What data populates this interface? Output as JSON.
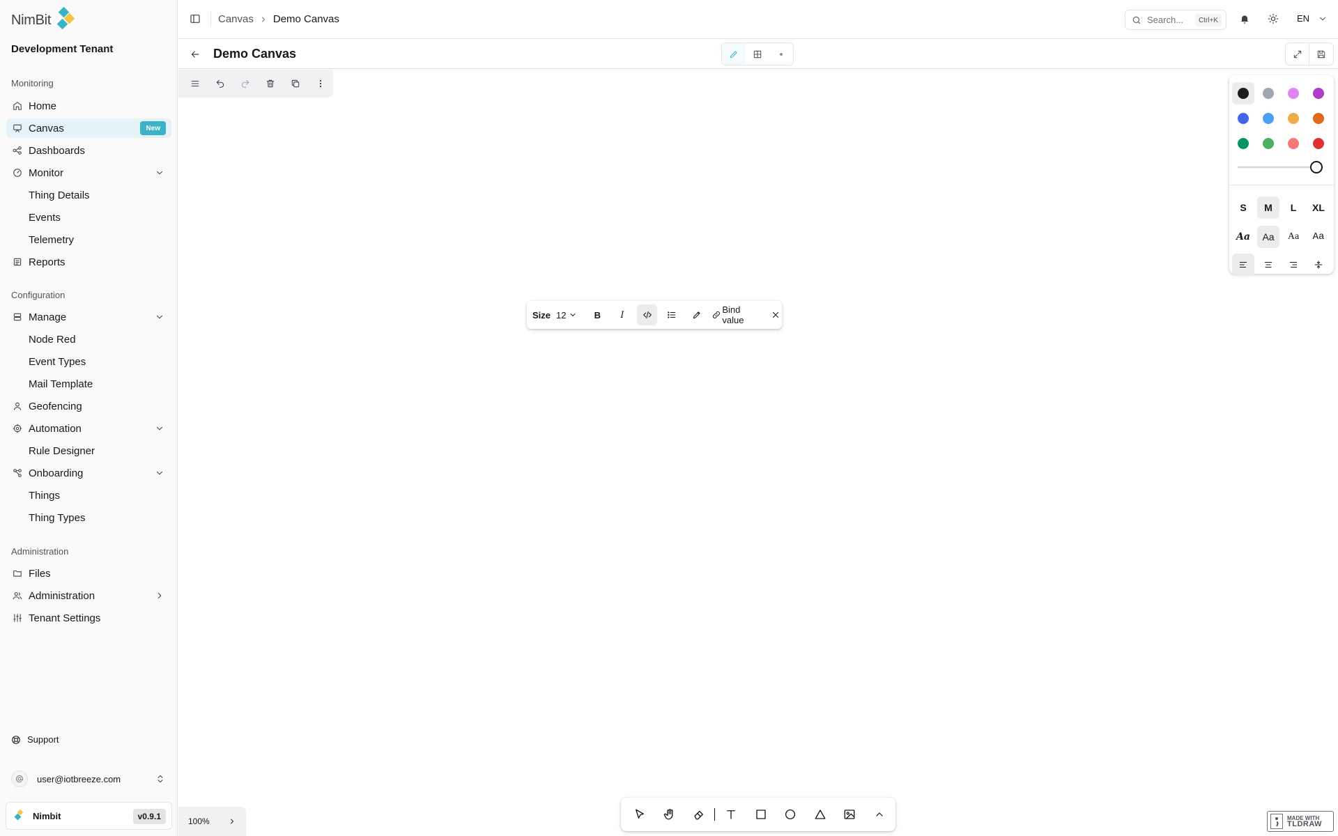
{
  "brand": {
    "logo_text": "NimBit",
    "tenant": "Development Tenant",
    "accent": "#3ab3c7"
  },
  "sidebar": {
    "groups": {
      "monitoring": "Monitoring",
      "configuration": "Configuration",
      "administration": "Administration"
    },
    "items": {
      "home": "Home",
      "canvas": "Canvas",
      "canvas_badge": "New",
      "dashboards": "Dashboards",
      "monitor": "Monitor",
      "thing_details": "Thing Details",
      "events": "Events",
      "telemetry": "Telemetry",
      "reports": "Reports",
      "manage": "Manage",
      "node_red": "Node Red",
      "event_types": "Event Types",
      "mail_template": "Mail Template",
      "geofencing": "Geofencing",
      "automation": "Automation",
      "rule_designer": "Rule Designer",
      "onboarding": "Onboarding",
      "things": "Things",
      "thing_types": "Thing Types",
      "files": "Files",
      "administration": "Administration",
      "tenant_settings": "Tenant Settings"
    },
    "support": "Support",
    "user_email": "user@iotbreeze.com",
    "app_name": "Nimbit",
    "version": "v0.9.1"
  },
  "header": {
    "breadcrumb": [
      "Canvas",
      "Demo Canvas"
    ],
    "search_placeholder": "Search...",
    "search_shortcut": "Ctrl+K",
    "language": "EN"
  },
  "canvas": {
    "title": "Demo Canvas",
    "zoom": "100%",
    "watermark_line1": "MADE WITH",
    "watermark_line2": "TLDRAW"
  },
  "style_panel": {
    "colors": [
      "#1d1d1d",
      "#9fa8b2",
      "#e085f4",
      "#ae3ec9",
      "#4465e9",
      "#4ba1f1",
      "#f1ac4b",
      "#e16919",
      "#099268",
      "#4cb05e",
      "#f87777",
      "#e03131"
    ],
    "selected_color_index": 0,
    "opacity": 1,
    "sizes": [
      "S",
      "M",
      "L",
      "XL"
    ],
    "selected_size": "M",
    "fonts": [
      "Aa",
      "Aa",
      "Aa",
      "Aa"
    ],
    "selected_font_index": 1,
    "selected_align_index": 0
  },
  "text_toolbar": {
    "size_label": "Size",
    "size_value": "12",
    "bold": "B",
    "italic": "I",
    "bind_label": "Bind value"
  }
}
